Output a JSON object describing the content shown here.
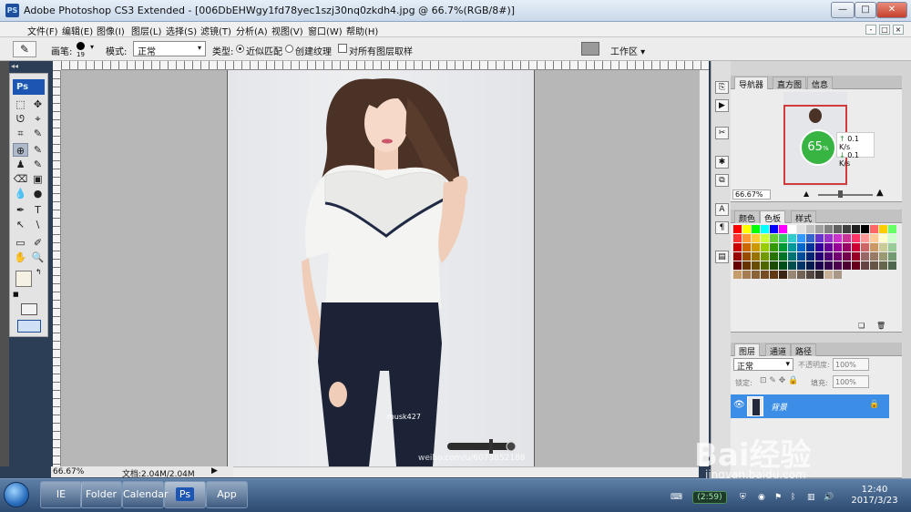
{
  "window": {
    "app_icon": "PS",
    "title": "Adobe Photoshop CS3 Extended - [006DbEHWgy1fd78yec1szj30nq0zkdh4.jpg @ 66.7%(RGB/8#)]",
    "minimize": "—",
    "maximize": "□",
    "close": "✕"
  },
  "menu": {
    "items": [
      "文件(F)",
      "编辑(E)",
      "图像(I)",
      "图层(L)",
      "选择(S)",
      "滤镜(T)",
      "分析(A)",
      "视图(V)",
      "窗口(W)",
      "帮助(H)"
    ]
  },
  "options": {
    "brush_label": "画笔:",
    "brush_size": "19",
    "mode_label": "模式:",
    "mode_value": "正常",
    "type_label": "类型:",
    "type_options": [
      "近似匹配",
      "创建纹理"
    ],
    "sample_all_label": "对所有图层取样",
    "workspace_label": "工作区 ▾"
  },
  "toolbox": {
    "logo": "Ps",
    "tools": [
      "⬚",
      "✥",
      "ᘎ",
      "⌖",
      "⌗",
      "✎",
      "⊕",
      "✎",
      "♟",
      "✎",
      "⌫",
      "▣",
      "💧",
      "●",
      "✒",
      "T",
      "↖",
      "\\",
      "▭",
      "✐",
      "✋",
      "🔍"
    ]
  },
  "status": {
    "zoom": "66.67%",
    "doc_info": "文档:2.04M/2.04M"
  },
  "navigator": {
    "tabs": [
      "导航器",
      "直方图",
      "信息"
    ],
    "zoom": "66.67%",
    "speed_badge": "65",
    "speed_unit": "%",
    "upload": "0.1 K/s",
    "download": "0.1 K/s"
  },
  "swatches": {
    "tabs": [
      "颜色",
      "色板",
      "样式"
    ],
    "colors": [
      "#ff0000",
      "#ffff00",
      "#00ff00",
      "#00ffff",
      "#0000ff",
      "#ff00ff",
      "#ffffff",
      "#e0e0e0",
      "#c0c0c0",
      "#a0a0a0",
      "#808080",
      "#606060",
      "#404040",
      "#202020",
      "#000000",
      "#ff6666",
      "#ffcc00",
      "#66ff66",
      "#ff3333",
      "#ff9933",
      "#ffcc33",
      "#ccff33",
      "#66cc33",
      "#33cc66",
      "#33cccc",
      "#3399ff",
      "#3366cc",
      "#6633cc",
      "#9933cc",
      "#cc33cc",
      "#cc3399",
      "#ff3366",
      "#ff9999",
      "#ffcc99",
      "#ffffcc",
      "#ccffcc",
      "#cc0000",
      "#cc6600",
      "#cc9900",
      "#99cc00",
      "#339900",
      "#009933",
      "#009999",
      "#0066cc",
      "#003399",
      "#330099",
      "#660099",
      "#990099",
      "#990066",
      "#cc0033",
      "#cc6666",
      "#cc9966",
      "#cccc99",
      "#99cc99",
      "#990000",
      "#994c00",
      "#997300",
      "#739900",
      "#267300",
      "#007326",
      "#007373",
      "#004c99",
      "#002673",
      "#260073",
      "#4c0073",
      "#730073",
      "#73004c",
      "#990026",
      "#996666",
      "#997a66",
      "#999973",
      "#739973",
      "#660000",
      "#663300",
      "#664d00",
      "#4d6600",
      "#1a4d00",
      "#004d1a",
      "#004d4d",
      "#003366",
      "#001a4d",
      "#1a004d",
      "#33004d",
      "#4d004d",
      "#4d0033",
      "#66001a",
      "#664444",
      "#665544",
      "#66664d",
      "#4d664d",
      "#c69c6d",
      "#a67c52",
      "#8c6239",
      "#754c24",
      "#603913",
      "#3c2415",
      "#998675",
      "#736357",
      "#534741",
      "#362f2d",
      "#c7b299",
      "#a99888"
    ]
  },
  "layers": {
    "tabs": [
      "图层",
      "通道",
      "路径"
    ],
    "blend_mode": "正常",
    "opacity_label": "不透明度:",
    "opacity_value": "100%",
    "lock_label": "锁定:",
    "fill_label": "填充:",
    "fill_value": "100%",
    "layer_name": "背景"
  },
  "photo": {
    "watermark_user": "musk427",
    "weibo_credit": "weibo.com/u/6073852188"
  },
  "taskbar": {
    "apps": [
      "IE",
      "Folder",
      "Calendar",
      "Ps",
      "App"
    ],
    "net_badge": "(2:59)",
    "time": "12:40",
    "date": "2017/3/23"
  },
  "baidu_watermark": {
    "brand": "Bai经验",
    "url": "jingyan.baidu.com"
  }
}
